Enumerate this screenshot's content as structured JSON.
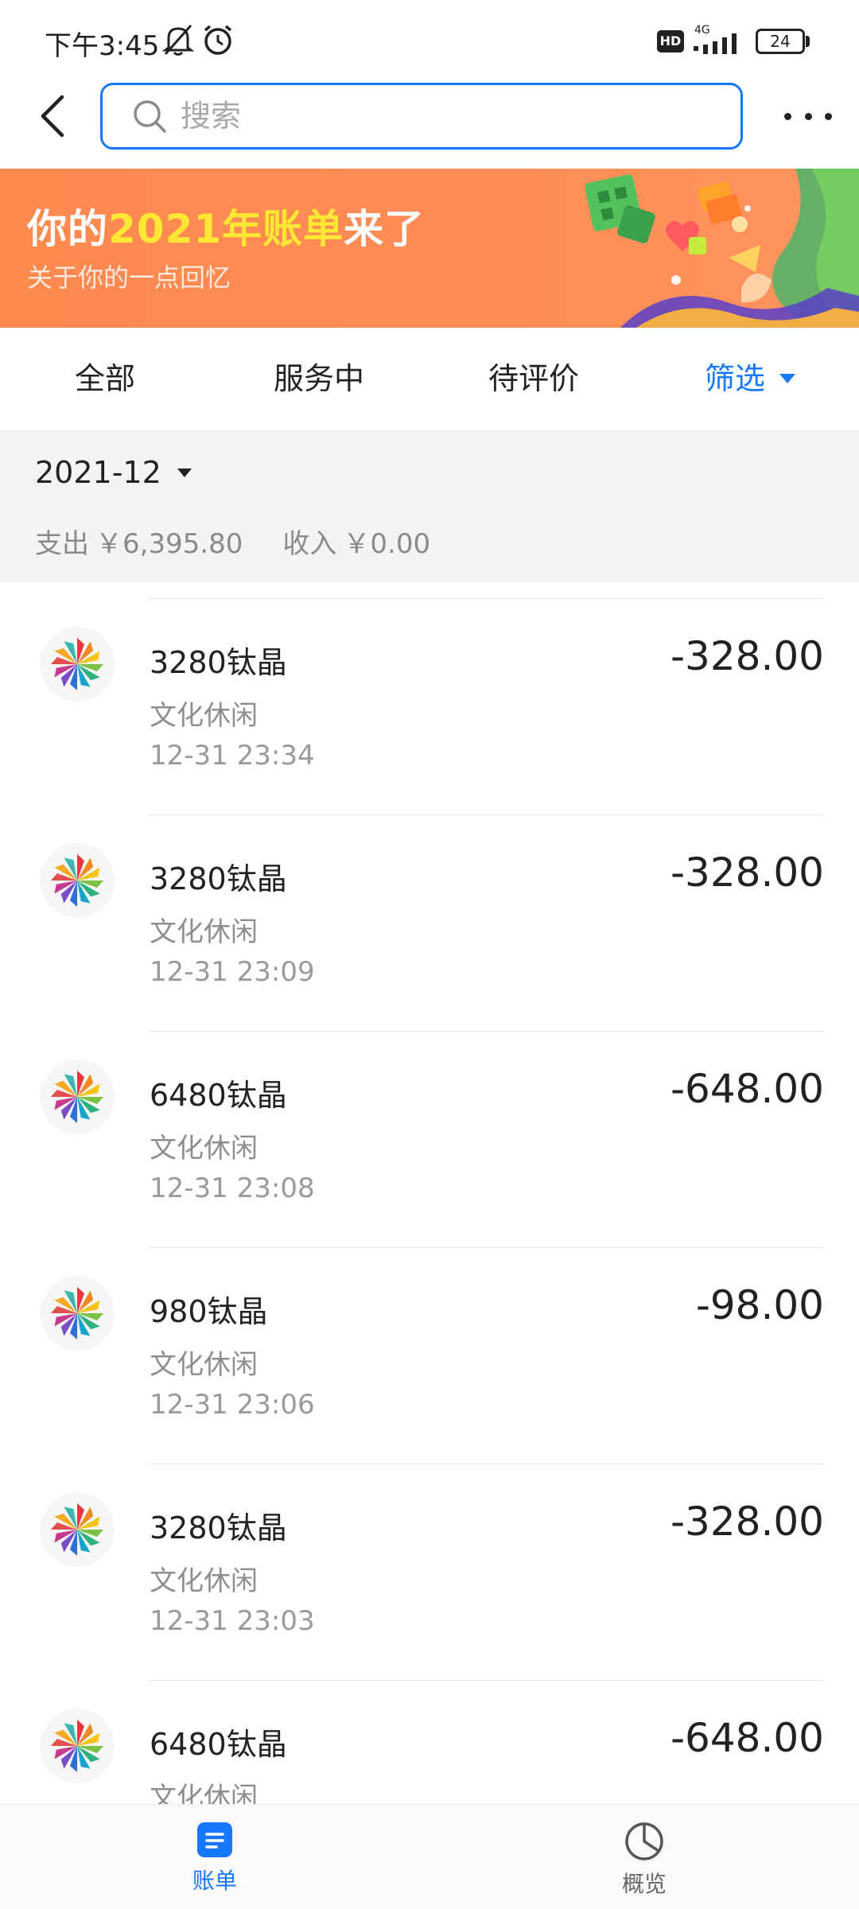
{
  "status_bar": {
    "time": "下午3:45",
    "network": "4G",
    "battery": "24"
  },
  "header": {
    "search_placeholder": "搜索"
  },
  "banner": {
    "title_prefix": "你的",
    "title_highlight": "2021年账单",
    "title_suffix": "来了",
    "subtitle": "关于你的一点回忆"
  },
  "tabs": [
    {
      "label": "全部",
      "active": false
    },
    {
      "label": "服务中",
      "active": false
    },
    {
      "label": "待评价",
      "active": false
    },
    {
      "label": "筛选",
      "active": true
    }
  ],
  "month": {
    "label": "2021-12",
    "expense_label": "支出",
    "expense_value": "￥6,395.80",
    "income_label": "收入",
    "income_value": "￥0.00"
  },
  "transactions": [
    {
      "title": "3280钛晶",
      "category": "文化休闲",
      "time": "12-31  23:34",
      "amount": "-328.00"
    },
    {
      "title": "3280钛晶",
      "category": "文化休闲",
      "time": "12-31  23:09",
      "amount": "-328.00"
    },
    {
      "title": "6480钛晶",
      "category": "文化休闲",
      "time": "12-31  23:08",
      "amount": "-648.00"
    },
    {
      "title": "980钛晶",
      "category": "文化休闲",
      "time": "12-31  23:06",
      "amount": "-98.00"
    },
    {
      "title": "3280钛晶",
      "category": "文化休闲",
      "time": "12-31  23:03",
      "amount": "-328.00"
    },
    {
      "title": "6480钛晶",
      "category": "文化休闲",
      "time": "",
      "amount": "-648.00"
    }
  ],
  "bottom_nav": [
    {
      "label": "账单",
      "icon": "bill-icon",
      "active": true
    },
    {
      "label": "概览",
      "icon": "pie-chart-icon",
      "active": false
    }
  ],
  "colors": {
    "accent": "#1677ff",
    "banner": "#ff8a50",
    "banner_highlight": "#ffe733"
  }
}
